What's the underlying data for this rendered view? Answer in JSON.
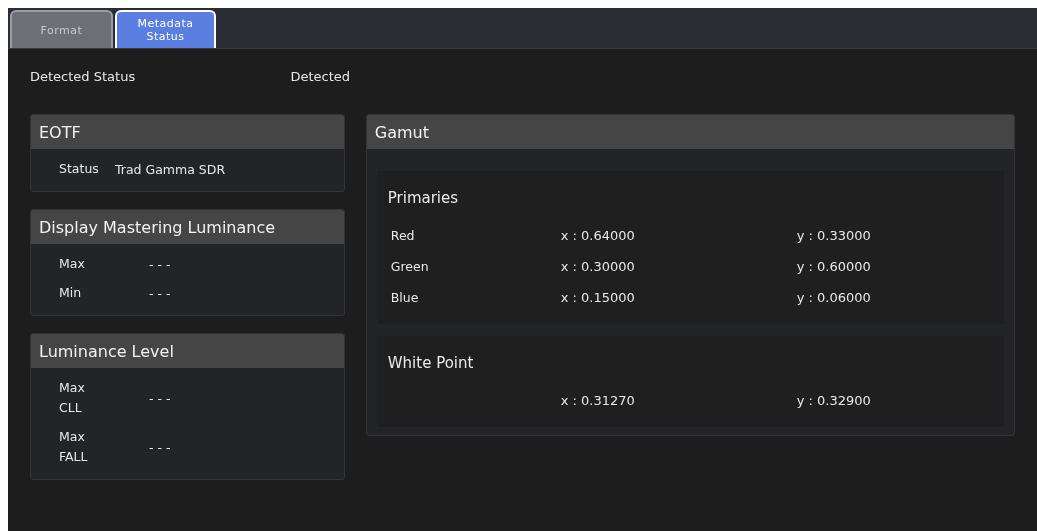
{
  "tabs": [
    {
      "label": "Format",
      "selected": false
    },
    {
      "label": "Metadata Status",
      "selected": true
    }
  ],
  "detected": {
    "label": "Detected Status",
    "value": "Detected"
  },
  "left_panels": [
    {
      "title": "EOTF",
      "rows": [
        {
          "label": "Status",
          "value": "Trad Gamma SDR"
        }
      ]
    },
    {
      "title": "Display Mastering Luminance",
      "rows": [
        {
          "label": "Max",
          "value": "- - -"
        },
        {
          "label": "Min",
          "value": "- - -"
        }
      ]
    },
    {
      "title": "Luminance Level",
      "rows": [
        {
          "label": "Max CLL",
          "value": "- - -"
        },
        {
          "label": "Max FALL",
          "value": "- - -"
        }
      ]
    }
  ],
  "gamut": {
    "title": "Gamut",
    "sections": [
      {
        "title": "Primaries",
        "rows": [
          {
            "label": "Red",
            "x": "x : 0.64000",
            "y": "y : 0.33000"
          },
          {
            "label": "Green",
            "x": "x : 0.30000",
            "y": "y : 0.60000"
          },
          {
            "label": "Blue",
            "x": "x : 0.15000",
            "y": "y : 0.06000"
          }
        ]
      },
      {
        "title": "White Point",
        "rows": [
          {
            "x": "x : 0.31270",
            "y": "y : 0.32900"
          }
        ]
      }
    ]
  }
}
